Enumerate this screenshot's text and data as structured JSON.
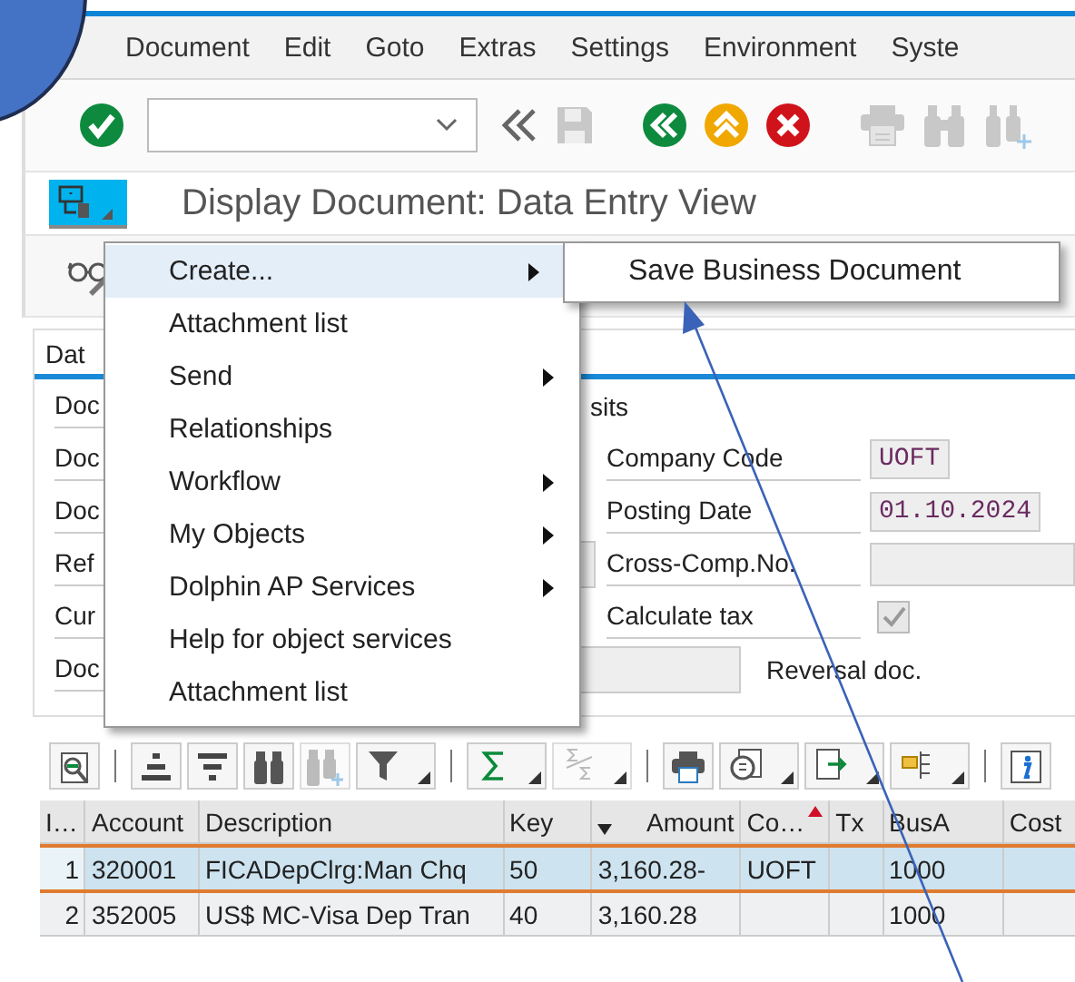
{
  "menu_bar": [
    {
      "label": "Document"
    },
    {
      "label": "Edit"
    },
    {
      "label": "Goto"
    },
    {
      "label": "Extras"
    },
    {
      "label": "Settings"
    },
    {
      "label": "Environment"
    },
    {
      "label": "Syste"
    }
  ],
  "toolbar": [
    {
      "kind": "enter",
      "disabled": false
    },
    {
      "kind": "command-field"
    },
    {
      "kind": "double-left",
      "disabled": false
    },
    {
      "kind": "save",
      "disabled": true
    },
    {
      "kind": "gap"
    },
    {
      "kind": "back",
      "disabled": false
    },
    {
      "kind": "exit",
      "disabled": false
    },
    {
      "kind": "cancel",
      "disabled": false
    },
    {
      "kind": "gap"
    },
    {
      "kind": "print",
      "disabled": true
    },
    {
      "kind": "find",
      "disabled": true
    },
    {
      "kind": "find-next",
      "disabled": true
    }
  ],
  "title": "Display Document: Data Entry View",
  "context_menu": [
    {
      "label": "Create...",
      "submenu": true,
      "selected": true
    },
    {
      "label": "Attachment list",
      "submenu": false,
      "selected": false
    },
    {
      "label": "Send",
      "submenu": true,
      "selected": false
    },
    {
      "label": "Relationships",
      "submenu": false,
      "selected": false
    },
    {
      "label": "Workflow",
      "submenu": true,
      "selected": false
    },
    {
      "label": "My Objects",
      "submenu": true,
      "selected": false
    },
    {
      "label": "Dolphin AP Services",
      "submenu": true,
      "selected": false
    },
    {
      "label": "Help for object services",
      "submenu": false,
      "selected": false
    },
    {
      "label": "Attachment list",
      "submenu": false,
      "selected": false
    }
  ],
  "submenu": [
    {
      "label": "Save Business Document",
      "selected": false
    }
  ],
  "form": {
    "tab": "Dat",
    "rows": [
      {
        "label": "Doc",
        "kind": "text",
        "text": "sits"
      },
      {
        "label": "Doc",
        "kind": "field",
        "field_label": "Company Code",
        "value": "UOFT"
      },
      {
        "label": "Doc",
        "kind": "field",
        "field_label": "Posting Date",
        "value": "01.10.2024"
      },
      {
        "label": "Ref",
        "kind": "stub-field",
        "field_label": "Cross-Comp.No."
      },
      {
        "label": "Cur",
        "kind": "checkbox",
        "field_label": "Calculate tax",
        "checked": true,
        "disabled": true
      },
      {
        "label": "Doc",
        "kind": "long-field",
        "field_label": "Reversal doc."
      }
    ]
  },
  "grid_toolbar": [
    {
      "kind": "details",
      "disabled": false,
      "dropdown": false
    },
    {
      "kind": "separator"
    },
    {
      "kind": "sort-asc",
      "disabled": false,
      "dropdown": false
    },
    {
      "kind": "sort-desc",
      "disabled": false,
      "dropdown": false
    },
    {
      "kind": "find",
      "disabled": false,
      "dropdown": false
    },
    {
      "kind": "find-next",
      "disabled": true,
      "dropdown": false
    },
    {
      "kind": "filter",
      "disabled": false,
      "dropdown": true
    },
    {
      "kind": "separator"
    },
    {
      "kind": "sum",
      "disabled": false,
      "dropdown": true
    },
    {
      "kind": "subtotal",
      "disabled": true,
      "dropdown": true
    },
    {
      "kind": "separator"
    },
    {
      "kind": "print",
      "disabled": false,
      "dropdown": false
    },
    {
      "kind": "views",
      "disabled": false,
      "dropdown": true
    },
    {
      "kind": "export",
      "disabled": false,
      "dropdown": true
    },
    {
      "kind": "layout",
      "disabled": false,
      "dropdown": true
    },
    {
      "kind": "separator"
    },
    {
      "kind": "info",
      "disabled": false,
      "dropdown": false
    }
  ],
  "table": {
    "columns": [
      {
        "label": "I…"
      },
      {
        "label": "Account"
      },
      {
        "label": "Description"
      },
      {
        "label": "Key"
      },
      {
        "label": "Amount",
        "sorted_descending": true
      },
      {
        "label": "Co…",
        "sorted_ascending": true
      },
      {
        "label": "Tx"
      },
      {
        "label": "BusA"
      },
      {
        "label": "Cost"
      }
    ],
    "rows": [
      {
        "selected": true,
        "cells": [
          "1",
          "320001",
          "FICADepClrg:Man Chq",
          "50",
          "3,160.28-",
          "UOFT",
          null,
          "1000",
          null
        ]
      },
      {
        "selected": false,
        "cells": [
          "2",
          "352005",
          "US$ MC-Visa Dep Tran",
          "40",
          "3,160.28",
          null,
          null,
          "1000",
          null
        ]
      }
    ]
  }
}
